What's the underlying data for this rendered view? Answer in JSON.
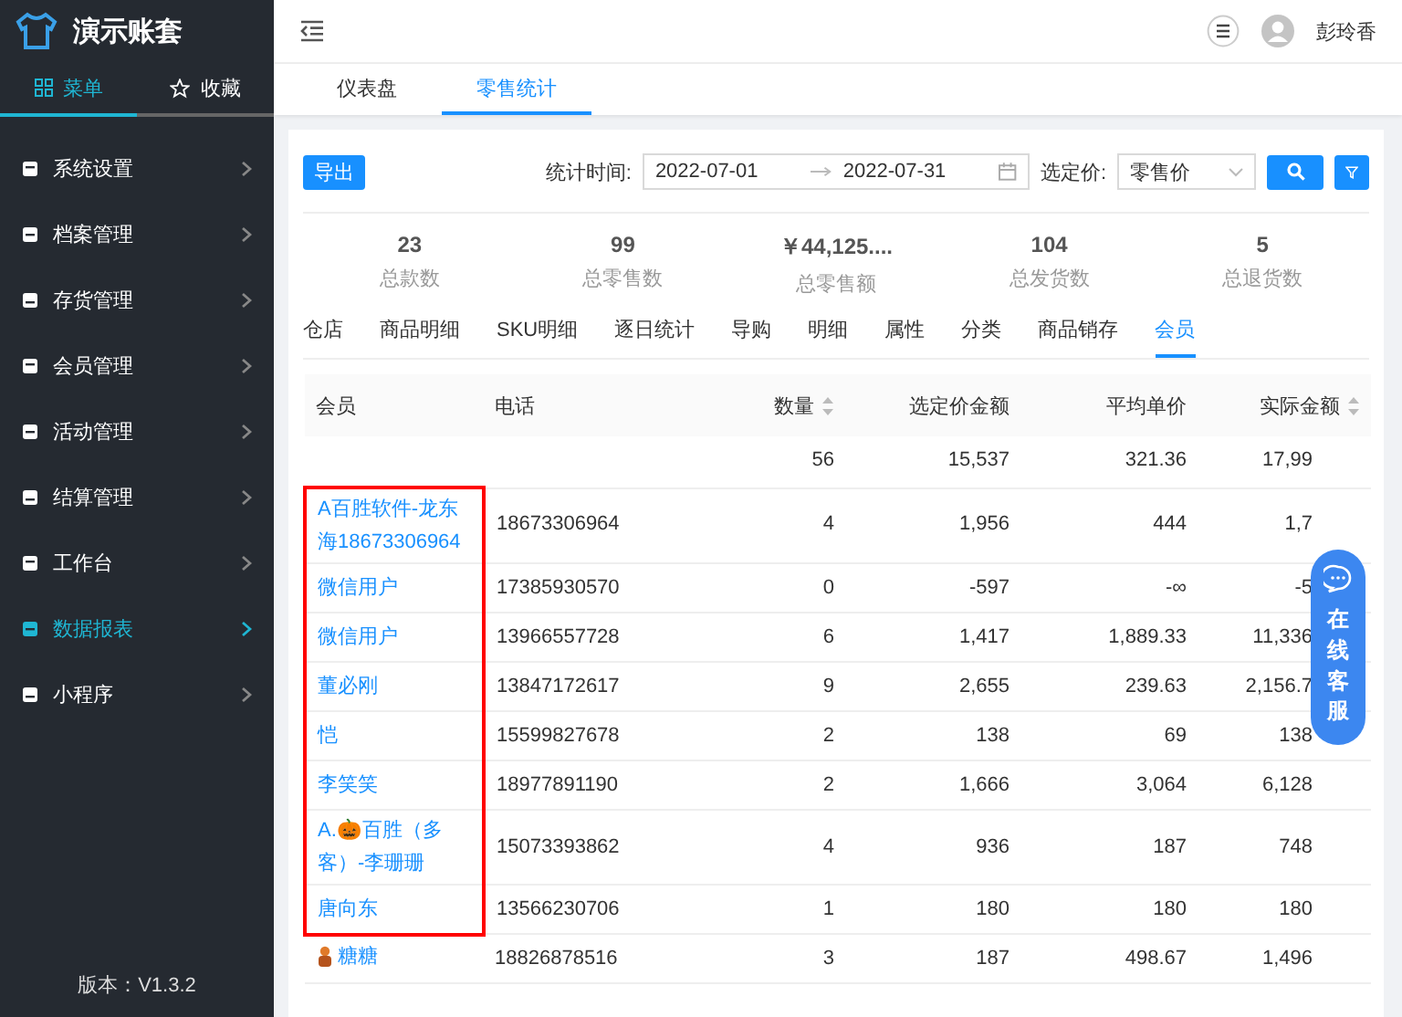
{
  "brand": {
    "title": "演示账套"
  },
  "sidebar_tabs": [
    {
      "label": "菜单",
      "selected": true
    },
    {
      "label": "收藏",
      "selected": false
    }
  ],
  "menu": [
    {
      "label": "系统设置",
      "selected": false
    },
    {
      "label": "档案管理",
      "selected": false
    },
    {
      "label": "存货管理",
      "selected": false
    },
    {
      "label": "会员管理",
      "selected": false
    },
    {
      "label": "活动管理",
      "selected": false
    },
    {
      "label": "结算管理",
      "selected": false
    },
    {
      "label": "工作台",
      "selected": false
    },
    {
      "label": "数据报表",
      "selected": true
    },
    {
      "label": "小程序",
      "selected": false
    }
  ],
  "version": "版本：V1.3.2",
  "user": {
    "name": "彭玲香"
  },
  "page_tabs": [
    {
      "label": "仪表盘",
      "selected": false
    },
    {
      "label": "零售统计",
      "selected": true
    }
  ],
  "toolbar": {
    "export": "导出",
    "time_label": "统计时间:",
    "date_from": "2022-07-01",
    "date_to": "2022-07-31",
    "price_label": "选定价:",
    "price_value": "零售价"
  },
  "stats": [
    {
      "value": "23",
      "label": "总款数"
    },
    {
      "value": "99",
      "label": "总零售数"
    },
    {
      "value": "￥44,125....",
      "label": "总零售额"
    },
    {
      "value": "104",
      "label": "总发货数"
    },
    {
      "value": "5",
      "label": "总退货数"
    }
  ],
  "report_tabs": [
    {
      "label": "仓店",
      "selected": false
    },
    {
      "label": "商品明细",
      "selected": false
    },
    {
      "label": "SKU明细",
      "selected": false
    },
    {
      "label": "逐日统计",
      "selected": false
    },
    {
      "label": "导购",
      "selected": false
    },
    {
      "label": "明细",
      "selected": false
    },
    {
      "label": "属性",
      "selected": false
    },
    {
      "label": "分类",
      "selected": false
    },
    {
      "label": "商品销存",
      "selected": false
    },
    {
      "label": "会员",
      "selected": true
    }
  ],
  "table": {
    "columns": [
      {
        "label": "会员",
        "sortable": false
      },
      {
        "label": "电话",
        "sortable": false
      },
      {
        "label": "数量",
        "sortable": true
      },
      {
        "label": "选定价金额",
        "sortable": false
      },
      {
        "label": "平均单价",
        "sortable": false
      },
      {
        "label": "实际金额",
        "sortable": true
      }
    ],
    "summary": [
      "56",
      "15,537",
      "321.36",
      "17,99"
    ],
    "rows": [
      {
        "member": "A百胜软件-龙东海18673306964",
        "phone": "18673306964",
        "qty": "4",
        "amount": "1,956",
        "avg": "444",
        "actual": "1,7",
        "avatar": false,
        "highlighted": true
      },
      {
        "member": "微信用户",
        "phone": "17385930570",
        "qty": "0",
        "amount": "-597",
        "avg": "-∞",
        "actual": "-5",
        "avatar": false,
        "highlighted": true
      },
      {
        "member": "微信用户",
        "phone": "13966557728",
        "qty": "6",
        "amount": "1,417",
        "avg": "1,889.33",
        "actual": "11,336",
        "avatar": false,
        "highlighted": true
      },
      {
        "member": "董必刚",
        "phone": "13847172617",
        "qty": "9",
        "amount": "2,655",
        "avg": "239.63",
        "actual": "2,156.7",
        "avatar": false,
        "highlighted": true
      },
      {
        "member": "恺",
        "phone": "15599827678",
        "qty": "2",
        "amount": "138",
        "avg": "69",
        "actual": "138",
        "avatar": false,
        "highlighted": true
      },
      {
        "member": "李笑笑",
        "phone": "18977891190",
        "qty": "2",
        "amount": "1,666",
        "avg": "3,064",
        "actual": "6,128",
        "avatar": false,
        "highlighted": true
      },
      {
        "member": "A.🎃百胜（多客）-李珊珊",
        "phone": "15073393862",
        "qty": "4",
        "amount": "936",
        "avg": "187",
        "actual": "748",
        "avatar": false,
        "highlighted": true
      },
      {
        "member": "唐向东",
        "phone": "13566230706",
        "qty": "1",
        "amount": "180",
        "avg": "180",
        "actual": "180",
        "avatar": false,
        "highlighted": true
      },
      {
        "member": "糖糖",
        "phone": "18826878516",
        "qty": "3",
        "amount": "187",
        "avg": "498.67",
        "actual": "1,496",
        "avatar": true,
        "highlighted": false
      }
    ]
  },
  "chat": {
    "label": "在线客服"
  }
}
